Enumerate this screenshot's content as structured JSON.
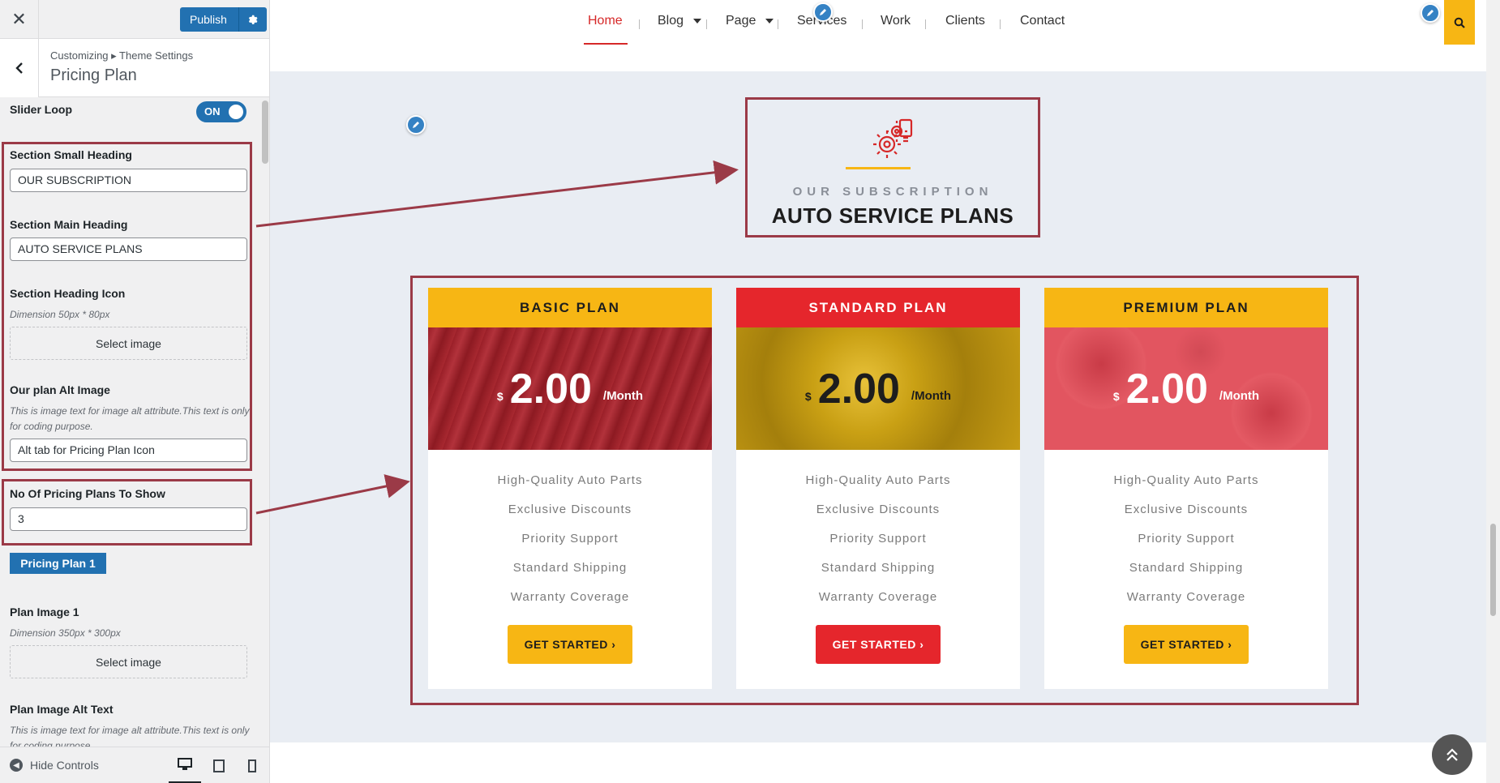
{
  "sidebar": {
    "publish_label": "Publish",
    "breadcrumb": "Customizing ▸ Theme Settings",
    "section_title": "Pricing Plan",
    "slider_loop": {
      "label": "Slider Loop",
      "state": "ON"
    },
    "small_heading": {
      "label": "Section Small Heading",
      "value": "OUR SUBSCRIPTION"
    },
    "main_heading": {
      "label": "Section Main Heading",
      "value": "AUTO SERVICE PLANS"
    },
    "heading_icon": {
      "label": "Section Heading Icon",
      "desc": "Dimension 50px * 80px",
      "button": "Select image"
    },
    "alt_image": {
      "label": "Our plan Alt Image",
      "desc": "This is image text for image alt attribute.This text is only for coding purpose.",
      "value": "Alt tab for Pricing Plan Icon"
    },
    "plans_count": {
      "label": "No Of Pricing Plans To Show",
      "value": "3"
    },
    "plan_tab": "Pricing Plan 1",
    "plan_image": {
      "label": "Plan Image 1",
      "desc": "Dimension 350px * 300px",
      "button": "Select image"
    },
    "plan_alt": {
      "label": "Plan Image Alt Text",
      "desc": "This is image text for image alt attribute.This text is only for coding purpose."
    },
    "hide_controls": "Hide Controls"
  },
  "nav": {
    "items": [
      "Home",
      "Blog",
      "Page",
      "Services",
      "Work",
      "Clients",
      "Contact"
    ],
    "active": "Home"
  },
  "section": {
    "small_heading": "OUR SUBSCRIPTION",
    "main_heading": "AUTO SERVICE PLANS"
  },
  "plans": [
    {
      "title": "BASIC PLAN",
      "currency": "$",
      "amount": "2.00",
      "period": "/Month",
      "features": [
        "High-Quality Auto Parts",
        "Exclusive Discounts",
        "Priority Support",
        "Standard Shipping",
        "Warranty Coverage"
      ],
      "cta": "GET STARTED ›",
      "accent": "#f7b614",
      "image_tint": "#a8222c"
    },
    {
      "title": "STANDARD PLAN",
      "currency": "$",
      "amount": "2.00",
      "period": "/Month",
      "features": [
        "High-Quality Auto Parts",
        "Exclusive Discounts",
        "Priority Support",
        "Standard Shipping",
        "Warranty Coverage"
      ],
      "cta": "GET STARTED ›",
      "accent": "#e5262c",
      "image_tint": "#c19a12"
    },
    {
      "title": "PREMIUM PLAN",
      "currency": "$",
      "amount": "2.00",
      "period": "/Month",
      "features": [
        "High-Quality Auto Parts",
        "Exclusive Discounts",
        "Priority Support",
        "Standard Shipping",
        "Warranty Coverage"
      ],
      "cta": "GET STARTED ›",
      "accent": "#f7b614",
      "image_tint": "#e45a64"
    }
  ],
  "colors": {
    "brand_yellow": "#f7b614",
    "brand_red": "#e5262c",
    "wp_blue": "#2271b1",
    "highlight": "#9b3a47"
  },
  "icons": [
    "close-icon",
    "gear-icon",
    "chevron-left-icon",
    "pencil-icon",
    "search-icon",
    "engine-gear-icon",
    "arrow-up-icon",
    "desktop-icon",
    "tablet-icon",
    "mobile-icon"
  ]
}
